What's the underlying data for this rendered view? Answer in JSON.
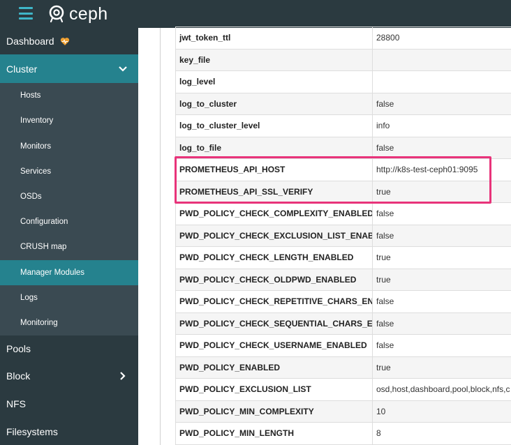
{
  "brand": {
    "name": "ceph"
  },
  "sidebar": {
    "dashboard_label": "Dashboard",
    "cluster_label": "Cluster",
    "cluster_items": [
      {
        "label": "Hosts"
      },
      {
        "label": "Inventory"
      },
      {
        "label": "Monitors"
      },
      {
        "label": "Services"
      },
      {
        "label": "OSDs"
      },
      {
        "label": "Configuration"
      },
      {
        "label": "CRUSH map"
      },
      {
        "label": "Manager Modules",
        "active": true
      },
      {
        "label": "Logs"
      },
      {
        "label": "Monitoring"
      }
    ],
    "pools_label": "Pools",
    "block_label": "Block",
    "nfs_label": "NFS",
    "filesystems_label": "Filesystems"
  },
  "settings": [
    {
      "key": "jwt_token_ttl",
      "value": "28800"
    },
    {
      "key": "key_file",
      "value": ""
    },
    {
      "key": "log_level",
      "value": ""
    },
    {
      "key": "log_to_cluster",
      "value": "false"
    },
    {
      "key": "log_to_cluster_level",
      "value": "info"
    },
    {
      "key": "log_to_file",
      "value": "false"
    },
    {
      "key": "PROMETHEUS_API_HOST",
      "value": "http://k8s-test-ceph01:9095"
    },
    {
      "key": "PROMETHEUS_API_SSL_VERIFY",
      "value": "true"
    },
    {
      "key": "PWD_POLICY_CHECK_COMPLEXITY_ENABLED",
      "value": "false"
    },
    {
      "key": "PWD_POLICY_CHECK_EXCLUSION_LIST_ENAB",
      "value": "false"
    },
    {
      "key": "PWD_POLICY_CHECK_LENGTH_ENABLED",
      "value": "true"
    },
    {
      "key": "PWD_POLICY_CHECK_OLDPWD_ENABLED",
      "value": "true"
    },
    {
      "key": "PWD_POLICY_CHECK_REPETITIVE_CHARS_EN",
      "value": "false"
    },
    {
      "key": "PWD_POLICY_CHECK_SEQUENTIAL_CHARS_EI",
      "value": "false"
    },
    {
      "key": "PWD_POLICY_CHECK_USERNAME_ENABLED",
      "value": "false"
    },
    {
      "key": "PWD_POLICY_ENABLED",
      "value": "true"
    },
    {
      "key": "PWD_POLICY_EXCLUSION_LIST",
      "value": "osd,host,dashboard,pool,block,nfs,c"
    },
    {
      "key": "PWD_POLICY_MIN_COMPLEXITY",
      "value": "10"
    },
    {
      "key": "PWD_POLICY_MIN_LENGTH",
      "value": "8"
    }
  ],
  "colors": {
    "accent": "#25828e",
    "highlight": "#e8337a",
    "heart": "#f0a030"
  }
}
